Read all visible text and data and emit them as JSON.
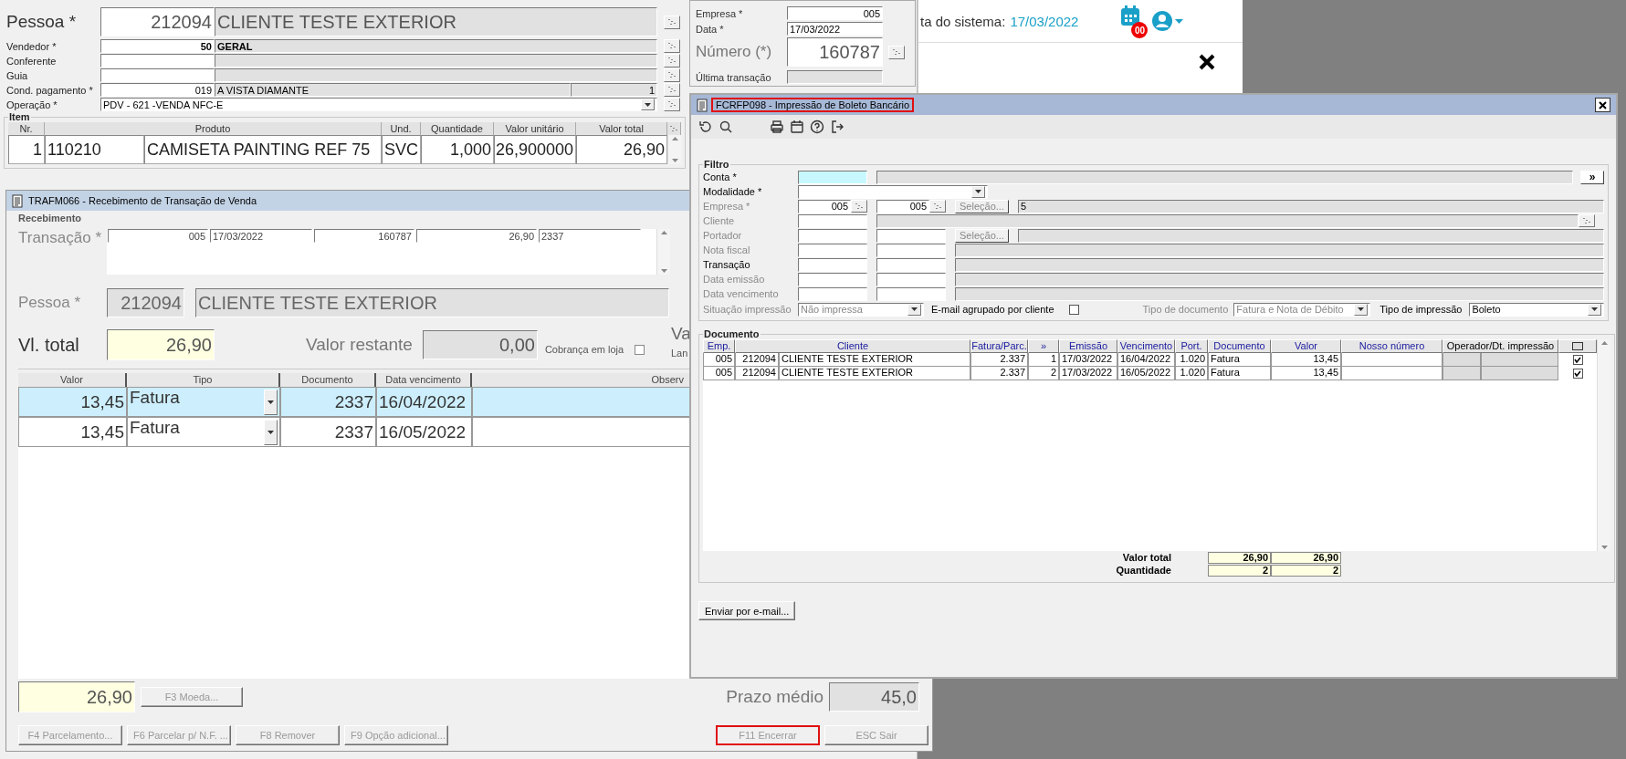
{
  "sales_form": {
    "pessoa": {
      "label": "Pessoa *",
      "code": "212094",
      "name": "CLIENTE TESTE EXTERIOR"
    },
    "fields": [
      {
        "kind": "lookup",
        "label": "Vendedor *",
        "code": "50",
        "name": "GERAL",
        "bold": true
      },
      {
        "kind": "lookup",
        "label": "Conferente"
      },
      {
        "kind": "lookup",
        "label": "Guia"
      },
      {
        "kind": "lookup",
        "label": "Cond. pagamento *",
        "code": "019",
        "name": "A VISTA DIAMANTE",
        "count": "1",
        "bold": false
      },
      {
        "kind": "combo",
        "label": "Operação *",
        "value": "PDV - 621 -VENDA NFC-E"
      }
    ],
    "header": {
      "empresa_label": "Empresa *",
      "empresa": "005",
      "data_label": "Data *",
      "data": "17/03/2022",
      "numero_label": "Número (*)",
      "numero": "160787",
      "ultima_label": "Última transação"
    },
    "item": {
      "title": "Item",
      "columns": [
        "Nr.",
        "Produto",
        "Und.",
        "Quantidade",
        "Valor unitário",
        "Valor total"
      ],
      "rows": [
        {
          "nr": "1",
          "code": "110210",
          "produto": "CAMISETA PAINTING REF 75",
          "und": "SVC",
          "quantidade": "1,000",
          "unitario": "26,900000",
          "total": "26,90"
        }
      ]
    }
  },
  "web_header": {
    "date_label": "ta do sistema:",
    "date": "17/03/2022",
    "badge": "00"
  },
  "receipt_window": {
    "title": "TRAFM066 - Recebimento de Transação de Venda",
    "section": "Recebimento",
    "transacao_label": "Transação *",
    "transacao": [
      "005",
      "17/03/2022",
      "160787",
      "26,90",
      "2337"
    ],
    "pessoa_label": "Pessoa *",
    "pessoa_code": "212094",
    "pessoa_name": "CLIENTE TESTE EXTERIOR",
    "total_label": "Vl. total",
    "total": "26,90",
    "restante_label": "Valor restante",
    "restante": "0,00",
    "cobranca_label": "Cobrança em loja",
    "cobranca_checked": false,
    "cut_label": "Va",
    "cut_label_small": "Lan",
    "columns": [
      "Valor",
      "Tipo",
      "Documento",
      "Data vencimento",
      "Observ"
    ],
    "rows": [
      {
        "valor": "13,45",
        "tipo": "Fatura",
        "documento": "2337",
        "vencimento": "16/04/2022",
        "selected": true
      },
      {
        "valor": "13,45",
        "tipo": "Fatura",
        "documento": "2337",
        "vencimento": "16/05/2022",
        "selected": false
      }
    ],
    "footer_total": "26,90",
    "currency_button": {
      "label": "F3 Moeda...",
      "disabled": true
    },
    "prazo_label": "Prazo médio",
    "prazo": "45,0",
    "left_buttons": [
      {
        "label": "F4 Parcelamento...",
        "disabled": true,
        "highlighted": false
      },
      {
        "label": "F6 Parcelar p/ N.F. ...",
        "disabled": true,
        "highlighted": false
      },
      {
        "label": "F8 Remover",
        "disabled": true,
        "highlighted": false
      },
      {
        "label": "F9 Opção adicional...",
        "disabled": true,
        "highlighted": false
      }
    ],
    "right_buttons": [
      {
        "label": "F11 Encerrar",
        "disabled": true,
        "highlighted": true
      },
      {
        "label": "ESC Sair",
        "disabled": true,
        "highlighted": false
      }
    ]
  },
  "boleto_window": {
    "title": "FCRFP098 - Impressão de Boleto Bancário",
    "title_highlighted": true,
    "filter_title": "Filtro",
    "filters": [
      {
        "label": "Conta *",
        "disabled": false,
        "cells": [
          {
            "kind": "input",
            "focused": true
          },
          {
            "kind": "display"
          },
          {
            "kind": "more",
            "text": "»"
          }
        ]
      },
      {
        "label": "Modalidade *",
        "disabled": false,
        "cells": [
          {
            "kind": "combo"
          }
        ]
      },
      {
        "label": "Empresa *",
        "disabled": true,
        "cells": [
          {
            "kind": "input",
            "value": "005",
            "lookup": true
          },
          {
            "kind": "input",
            "value": "005",
            "lookup": true
          },
          {
            "kind": "select",
            "text": "Seleção..."
          },
          {
            "kind": "display",
            "value": "5"
          }
        ]
      },
      {
        "label": "Cliente",
        "disabled": true,
        "cells": [
          {
            "kind": "input"
          },
          {
            "kind": "display"
          },
          {
            "kind": "lookup"
          }
        ]
      },
      {
        "label": "Portador",
        "disabled": true,
        "cells": [
          {
            "kind": "input"
          },
          {
            "kind": "input"
          },
          {
            "kind": "select",
            "text": "Seleção..."
          },
          {
            "kind": "display"
          }
        ]
      },
      {
        "label": "Nota fiscal",
        "disabled": true,
        "cells": [
          {
            "kind": "input"
          },
          {
            "kind": "input"
          },
          {
            "kind": "display"
          }
        ]
      },
      {
        "label": "Transação",
        "disabled": false,
        "cells": [
          {
            "kind": "input"
          },
          {
            "kind": "input"
          },
          {
            "kind": "display"
          }
        ]
      },
      {
        "label": "Data emissão",
        "disabled": true,
        "cells": [
          {
            "kind": "input"
          },
          {
            "kind": "input"
          },
          {
            "kind": "display"
          }
        ]
      },
      {
        "label": "Data vencimento",
        "disabled": true,
        "cells": [
          {
            "kind": "input"
          },
          {
            "kind": "input"
          },
          {
            "kind": "display"
          }
        ]
      }
    ],
    "options": {
      "situacao_label": "Situação impressão",
      "situacao": "Não impressa",
      "email_label": "E-mail agrupado por cliente",
      "email_checked": false,
      "tipo_doc_label": "Tipo de documento",
      "tipo_doc": "Fatura e Nota de Débito",
      "tipo_imp_label": "Tipo de impressão",
      "tipo_imp": "Boleto"
    },
    "document_title": "Documento",
    "columns": [
      "Emp.",
      "Cliente",
      "Fatura/Parc.",
      "»",
      "Emissão",
      "Vencimento",
      "Port.",
      "Documento",
      "Valor",
      "Nosso número",
      "Operador/Dt. impressão"
    ],
    "rows": [
      {
        "emp": "005",
        "cliente_code": "212094",
        "cliente": "CLIENTE TESTE EXTERIOR",
        "fatura": "2.337",
        "parcela": "1",
        "emissao": "17/03/2022",
        "vencimento": "16/04/2022",
        "portador": "1.020",
        "documento": "Fatura",
        "valor": "13,45",
        "checked": true
      },
      {
        "emp": "005",
        "cliente_code": "212094",
        "cliente": "CLIENTE TESTE EXTERIOR",
        "fatura": "2.337",
        "parcela": "2",
        "emissao": "17/03/2022",
        "vencimento": "16/05/2022",
        "portador": "1.020",
        "documento": "Fatura",
        "valor": "13,45",
        "checked": true
      }
    ],
    "totals": [
      {
        "label": "Valor total",
        "documento": "26,90",
        "valor": "26,90"
      },
      {
        "label": "Quantidade",
        "documento": "2",
        "valor": "2"
      }
    ],
    "email_button": "Enviar por e-mail..."
  }
}
